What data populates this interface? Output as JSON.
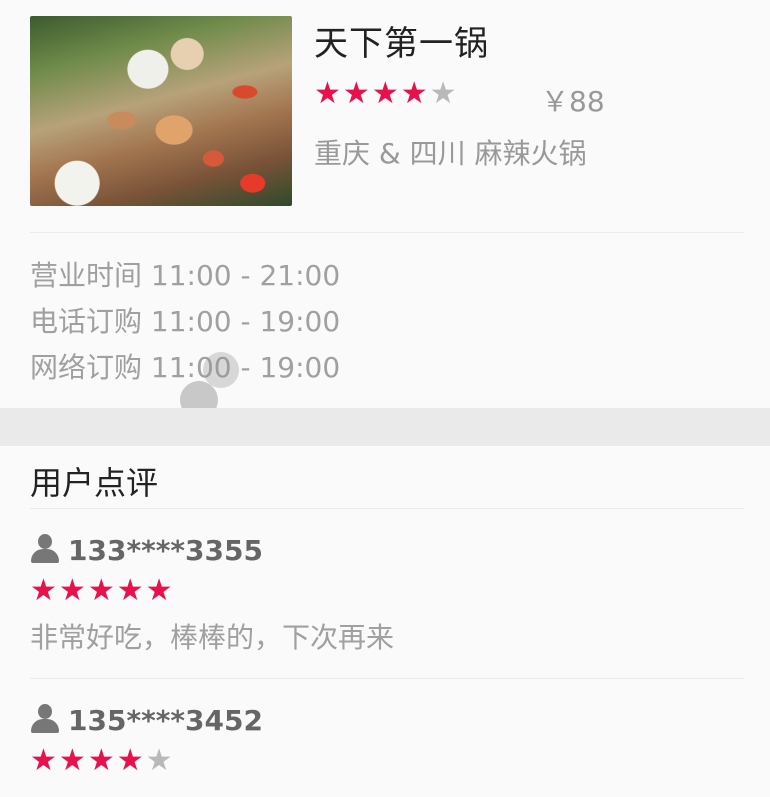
{
  "shop": {
    "name": "天下第一锅",
    "rating": 4,
    "max_rating": 5,
    "price": "￥88",
    "category": "重庆 & 四川 麻辣火锅",
    "photo_icon": "food-photo"
  },
  "hours": {
    "items": [
      {
        "label": "营业时间 11:00 - 21:00"
      },
      {
        "label": "电话订购 11:00 - 19:00"
      },
      {
        "label": "网络订购 11:00 - 19:00"
      }
    ]
  },
  "reviews": {
    "title": "用户点评",
    "items": [
      {
        "user": "133****3355",
        "rating": 5,
        "text": "非常好吃，棒棒的，下次再来"
      },
      {
        "user": "135****3452",
        "rating": 4,
        "text": ""
      }
    ]
  },
  "colors": {
    "star_on": "#e8114c",
    "star_off": "#b9b9b9",
    "muted_text": "#a0a0a0",
    "band": "#eaeaea"
  }
}
